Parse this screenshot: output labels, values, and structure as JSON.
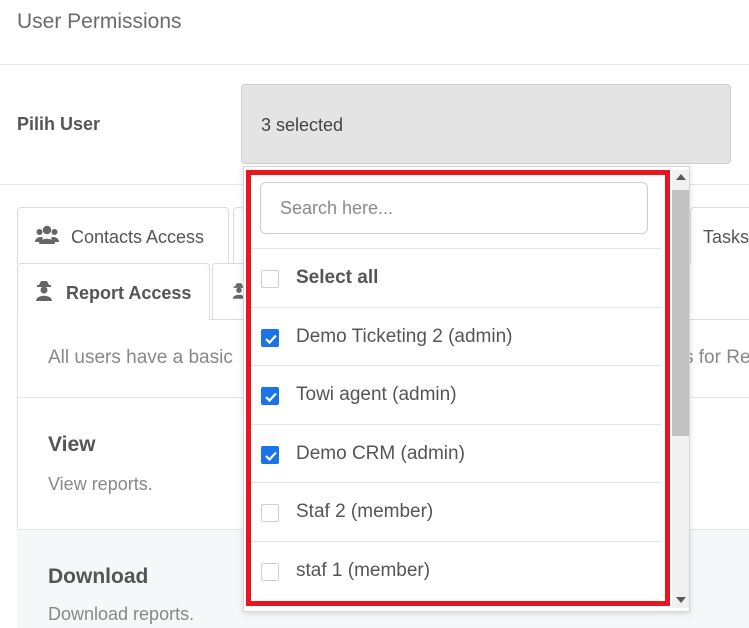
{
  "header": {
    "title": "User Permissions"
  },
  "user_select": {
    "label": "Pilih User",
    "value": "3 selected"
  },
  "tabs_row1": [
    {
      "label": "Contacts Access",
      "icon": "users-icon"
    },
    {
      "label": "Tasks"
    }
  ],
  "tabs_row2": [
    {
      "label": "Report Access",
      "icon": "user-secret-icon",
      "active": true
    },
    {
      "label": "",
      "icon": "user-secret-icon"
    }
  ],
  "panel": {
    "info_left": "All users have a basic",
    "info_right": "s for Re",
    "sections": [
      {
        "title": "View",
        "description": "View reports."
      },
      {
        "title": "Download",
        "description": "Download reports."
      }
    ]
  },
  "dropdown": {
    "search_placeholder": "Search here...",
    "select_all_label": "Select all",
    "options": [
      {
        "label": "Demo Ticketing 2 (admin)",
        "checked": true
      },
      {
        "label": "Towi agent (admin)",
        "checked": true
      },
      {
        "label": "Demo CRM (admin)",
        "checked": true
      },
      {
        "label": "Staf 2 (member)",
        "checked": false
      },
      {
        "label": "staf 1 (member)",
        "checked": false
      }
    ]
  },
  "colors": {
    "highlight": "#e8161f",
    "checkbox_checked": "#1a73e8",
    "select_bg": "#e4e4e4"
  }
}
